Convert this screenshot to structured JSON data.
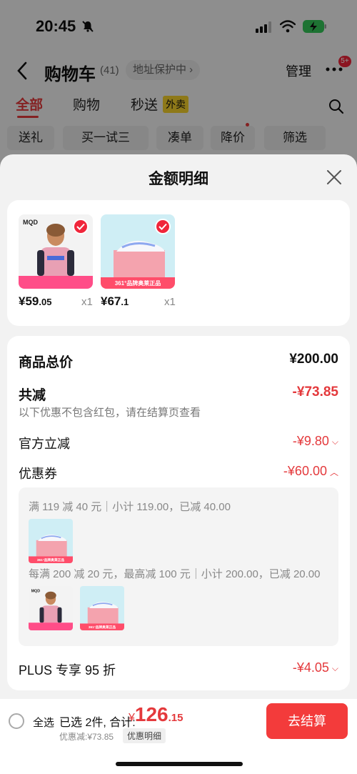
{
  "status_bar": {
    "time": "20:45"
  },
  "nav": {
    "title": "购物车",
    "count": "(41)",
    "address": "地址保护中 ›",
    "manage": "管理",
    "badge": "5+"
  },
  "tabs": [
    {
      "label": "全部"
    },
    {
      "label": "购物"
    },
    {
      "label": "秒送"
    }
  ],
  "tab_tag": "外卖",
  "chips": [
    {
      "label": "送礼"
    },
    {
      "label": "买一试三"
    },
    {
      "label": "凑单"
    },
    {
      "label": "降价"
    },
    {
      "label": "筛选"
    }
  ],
  "sheet": {
    "title": "金额明细",
    "products": [
      {
        "brand": "MQD",
        "price_int": "¥59",
        "price_dec": ".05",
        "qty": "x1"
      },
      {
        "brand": "361°品牌奥莱正品",
        "price_int": "¥67",
        "price_dec": ".1",
        "qty": "x1"
      }
    ],
    "summary": {
      "goods_total_label": "商品总价",
      "goods_total_value": "¥200.00",
      "total_discount_label": "共减",
      "total_discount_value": "-¥73.85",
      "note": "以下优惠不包含红包，请在结算页查看",
      "official_label": "官方立减",
      "official_value": "-¥9.80",
      "coupon_label": "优惠券",
      "coupon_value": "-¥60.00",
      "coupon_line1": "满 119 减 40 元｜小计 119.00，已减 40.00",
      "coupon_line2": "每满 200 减 20 元，最高减 100 元｜小计 200.00，已减 20.00",
      "plus_label": "PLUS 专享 95 折",
      "plus_value": "-¥4.05"
    }
  },
  "bottom_bar": {
    "select_all": "全选",
    "selected": "已选 2件, 合计:",
    "total_currency": "¥",
    "total_int": "126",
    "total_dec": ".15",
    "discount": "优惠减:¥73.85",
    "detail_link": "优惠明细",
    "checkout": "去结算"
  },
  "colors": {
    "accent": "#e4393c",
    "checkout_bg": "#f33b3b",
    "coupon_tag": "#f5d02b"
  }
}
